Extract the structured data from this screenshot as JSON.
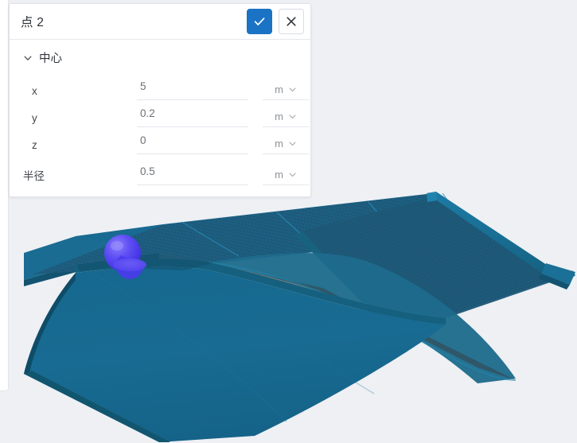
{
  "panel": {
    "title": "点 2",
    "confirm_label": "✓",
    "confirm_icon": "check-icon",
    "cancel_label": "✕",
    "cancel_icon": "close-icon",
    "accent_color": "#1a73c5",
    "section": {
      "label": "中心",
      "expanded": true,
      "chevron_icon": "chevron-down-icon"
    },
    "fields": [
      {
        "label": "x",
        "value": "5",
        "unit": "m",
        "unit_icon": "chevron-down-icon"
      },
      {
        "label": "y",
        "value": "0.2",
        "unit": "m",
        "unit_icon": "chevron-down-icon"
      },
      {
        "label": "z",
        "value": "0",
        "unit": "m",
        "unit_icon": "chevron-down-icon"
      }
    ],
    "radius_field": {
      "label": "半径",
      "value": "0.5",
      "unit": "m",
      "unit_icon": "chevron-down-icon"
    }
  },
  "viewport": {
    "name": "3d-model-viewport",
    "background_color": "#eef0f4",
    "surface_color": "#1b6d96",
    "surface_dark_color": "#15587a",
    "mesh_color": "#2a3f4a",
    "edge_color": "#2f9fd0",
    "marker": {
      "name": "point-marker-sphere",
      "color": "#5243f0",
      "highlight_color": "#7a6ef7"
    }
  }
}
